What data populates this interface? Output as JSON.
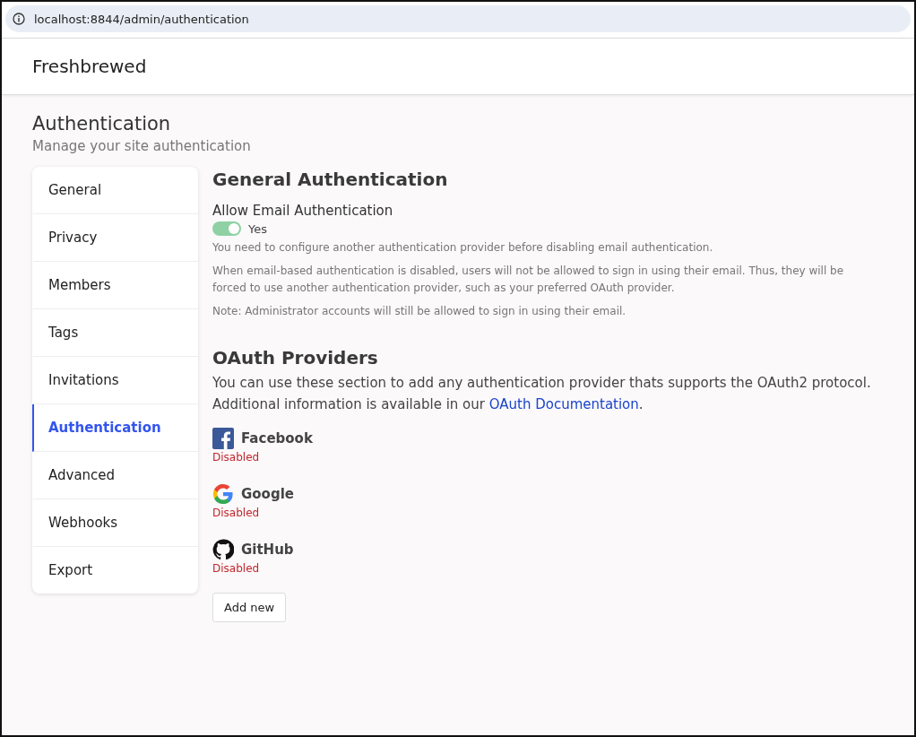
{
  "browser": {
    "url": "localhost:8844/admin/authentication"
  },
  "header": {
    "site_title": "Freshbrewed"
  },
  "page": {
    "title": "Authentication",
    "subtitle": "Manage your site authentication"
  },
  "sidebar": {
    "items": [
      {
        "label": "General",
        "selected": false
      },
      {
        "label": "Privacy",
        "selected": false
      },
      {
        "label": "Members",
        "selected": false
      },
      {
        "label": "Tags",
        "selected": false
      },
      {
        "label": "Invitations",
        "selected": false
      },
      {
        "label": "Authentication",
        "selected": true
      },
      {
        "label": "Advanced",
        "selected": false
      },
      {
        "label": "Webhooks",
        "selected": false
      },
      {
        "label": "Export",
        "selected": false
      }
    ]
  },
  "general": {
    "heading": "General Authentication",
    "setting_label": "Allow Email Authentication",
    "toggle": {
      "on": true,
      "label": "Yes"
    },
    "notes": [
      "You need to configure another authentication provider before disabling email authentication.",
      "When email-based authentication is disabled, users will not be allowed to sign in using their email. Thus, they will be forced to use another authentication provider, such as your preferred OAuth provider.",
      "Note: Administrator accounts will still be allowed to sign in using their email."
    ]
  },
  "oauth": {
    "heading": "OAuth Providers",
    "description": "You can use these section to add any authentication provider thats supports the OAuth2 protocol.",
    "info": {
      "text": "Additional information is available in our ",
      "link": "OAuth Documentation",
      "after": "."
    },
    "providers": [
      {
        "kind": "facebook",
        "name": "Facebook",
        "status": "Disabled"
      },
      {
        "kind": "google",
        "name": "Google",
        "status": "Disabled"
      },
      {
        "kind": "github",
        "name": "GitHub",
        "status": "Disabled"
      }
    ],
    "add_button": "Add new"
  }
}
